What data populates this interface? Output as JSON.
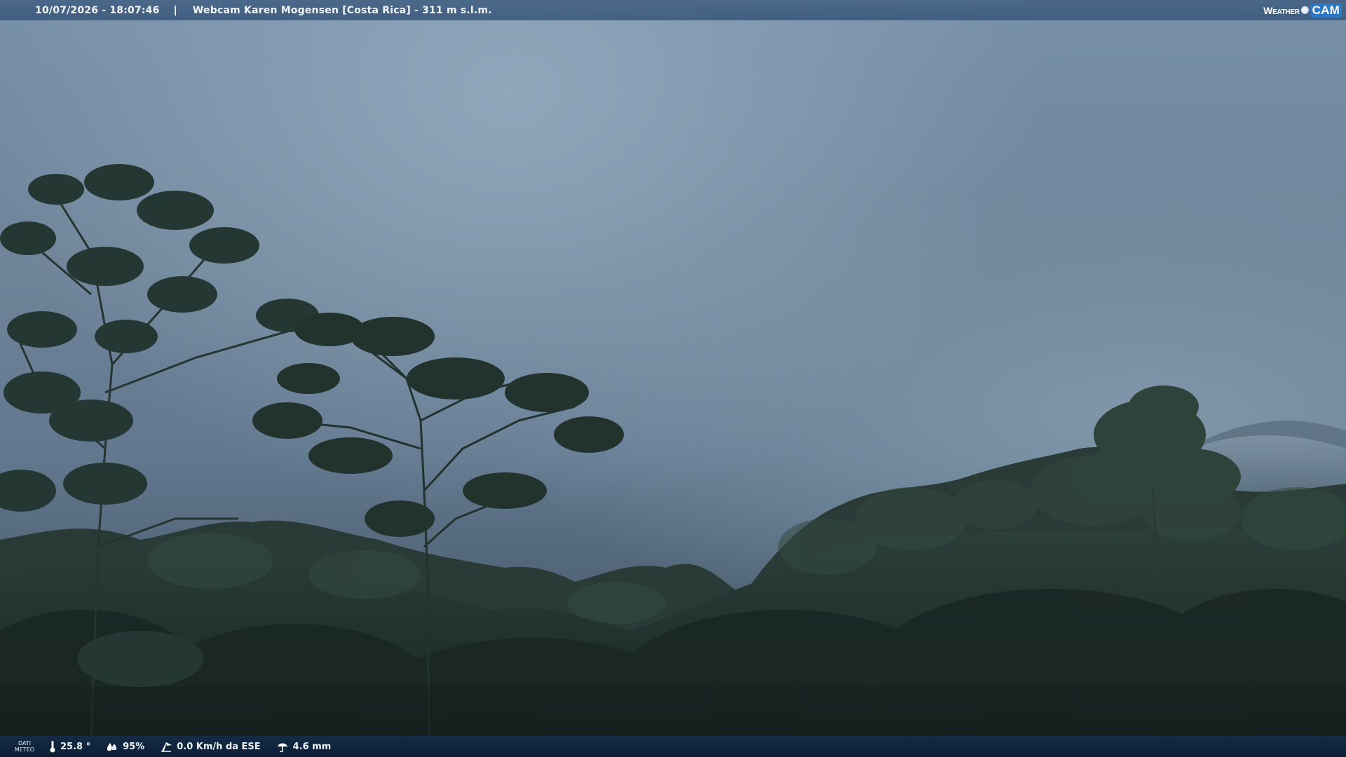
{
  "header": {
    "datetime": "10/07/2026 - 18:07:46",
    "separator": "|",
    "title": "Webcam Karen Mogensen [Costa Rica]  - 311 m s.l.m.",
    "logo_text_1": "Weather",
    "logo_text_2": "CAM"
  },
  "footer": {
    "label_line1": "DATI",
    "label_line2": "METEO",
    "temperature": "25.8 °",
    "humidity": "95%",
    "wind": "0.0 Km/h da ESE",
    "rain": "4.6 mm"
  },
  "icons": {
    "temperature": "thermometer-icon",
    "humidity": "humidity-icon",
    "wind": "wind-icon",
    "rain": "rain-icon"
  },
  "colors": {
    "topbar": "#46648a",
    "bottombar": "#142d4b",
    "sky": "#7690a8",
    "foliage": "#1e2d28"
  }
}
